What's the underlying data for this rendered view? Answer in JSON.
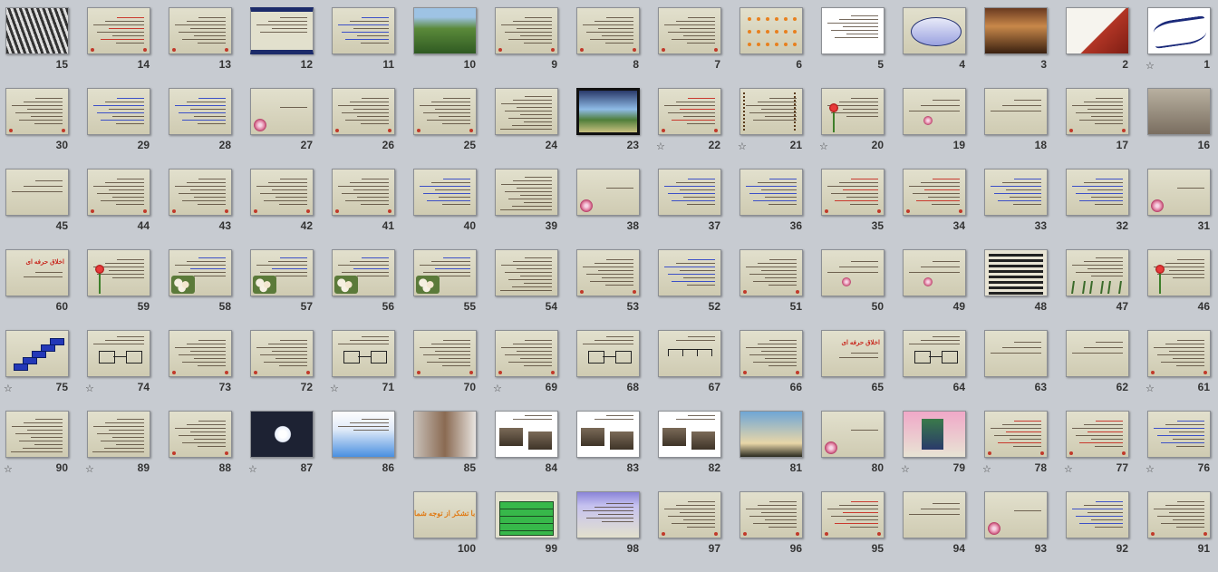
{
  "view": "slide-sorter",
  "slides": [
    {
      "number": "1",
      "text": "",
      "starred": true,
      "kind": "calligraphy"
    },
    {
      "number": "2",
      "text": "",
      "starred": false,
      "kind": "hand-photo"
    },
    {
      "number": "3",
      "text": "",
      "starred": false,
      "kind": "photo-dark"
    },
    {
      "number": "4",
      "text": "",
      "starred": false,
      "kind": "oval"
    },
    {
      "number": "5",
      "text": "",
      "starred": false,
      "kind": "white-list"
    },
    {
      "number": "6",
      "text": "",
      "starred": false,
      "kind": "dots"
    },
    {
      "number": "7",
      "text": "",
      "starred": false,
      "kind": "text"
    },
    {
      "number": "8",
      "text": "",
      "starred": false,
      "kind": "text"
    },
    {
      "number": "9",
      "text": "",
      "starred": false,
      "kind": "text"
    },
    {
      "number": "10",
      "text": "",
      "starred": false,
      "kind": "landscape"
    },
    {
      "number": "11",
      "text": "",
      "starred": false,
      "kind": "text-blue"
    },
    {
      "number": "12",
      "text": "",
      "starred": false,
      "kind": "framed"
    },
    {
      "number": "13",
      "text": "",
      "starred": false,
      "kind": "text"
    },
    {
      "number": "14",
      "text": "",
      "starred": false,
      "kind": "text-red"
    },
    {
      "number": "15",
      "text": "",
      "starred": false,
      "kind": "zebra"
    },
    {
      "number": "16",
      "text": "",
      "starred": false,
      "kind": "rhino"
    },
    {
      "number": "17",
      "text": "",
      "starred": false,
      "kind": "text"
    },
    {
      "number": "18",
      "text": "",
      "starred": false,
      "kind": "sparse"
    },
    {
      "number": "19",
      "text": "",
      "starred": false,
      "kind": "sparse-flower"
    },
    {
      "number": "20",
      "text": "",
      "starred": true,
      "kind": "rose-text"
    },
    {
      "number": "21",
      "text": "",
      "starred": true,
      "kind": "vine"
    },
    {
      "number": "22",
      "text": "",
      "starred": true,
      "kind": "text-red"
    },
    {
      "number": "23",
      "text": "",
      "starred": false,
      "kind": "lake"
    },
    {
      "number": "24",
      "text": "",
      "starred": false,
      "kind": "text-dense"
    },
    {
      "number": "25",
      "text": "",
      "starred": false,
      "kind": "text"
    },
    {
      "number": "26",
      "text": "",
      "starred": false,
      "kind": "text"
    },
    {
      "number": "27",
      "text": "",
      "starred": false,
      "kind": "title-flower"
    },
    {
      "number": "28",
      "text": "",
      "starred": false,
      "kind": "text-blue"
    },
    {
      "number": "29",
      "text": "",
      "starred": false,
      "kind": "text-blue"
    },
    {
      "number": "30",
      "text": "",
      "starred": false,
      "kind": "text"
    },
    {
      "number": "31",
      "text": "",
      "starred": false,
      "kind": "title-flower"
    },
    {
      "number": "32",
      "text": "",
      "starred": false,
      "kind": "text-blue"
    },
    {
      "number": "33",
      "text": "",
      "starred": false,
      "kind": "text-blue"
    },
    {
      "number": "34",
      "text": "",
      "starred": false,
      "kind": "text-red"
    },
    {
      "number": "35",
      "text": "",
      "starred": false,
      "kind": "text-red"
    },
    {
      "number": "36",
      "text": "",
      "starred": false,
      "kind": "text-blue"
    },
    {
      "number": "37",
      "text": "",
      "starred": false,
      "kind": "text-blue"
    },
    {
      "number": "38",
      "text": "",
      "starred": false,
      "kind": "title-flower"
    },
    {
      "number": "39",
      "text": "",
      "starred": false,
      "kind": "text-dense"
    },
    {
      "number": "40",
      "text": "",
      "starred": false,
      "kind": "text-blue"
    },
    {
      "number": "41",
      "text": "",
      "starred": false,
      "kind": "text"
    },
    {
      "number": "42",
      "text": "",
      "starred": false,
      "kind": "text"
    },
    {
      "number": "43",
      "text": "",
      "starred": false,
      "kind": "text"
    },
    {
      "number": "44",
      "text": "",
      "starred": false,
      "kind": "text"
    },
    {
      "number": "45",
      "text": "",
      "starred": false,
      "kind": "sparse"
    },
    {
      "number": "46",
      "text": "",
      "starred": false,
      "kind": "rose-text"
    },
    {
      "number": "47",
      "text": "",
      "starred": false,
      "kind": "grass"
    },
    {
      "number": "48",
      "text": "",
      "starred": false,
      "kind": "table"
    },
    {
      "number": "49",
      "text": "",
      "starred": false,
      "kind": "sparse-flower"
    },
    {
      "number": "50",
      "text": "",
      "starred": false,
      "kind": "sparse-flower"
    },
    {
      "number": "51",
      "text": "",
      "starred": false,
      "kind": "text"
    },
    {
      "number": "52",
      "text": "",
      "starred": false,
      "kind": "text-blue"
    },
    {
      "number": "53",
      "text": "",
      "starred": false,
      "kind": "text"
    },
    {
      "number": "54",
      "text": "",
      "starred": false,
      "kind": "text-dense"
    },
    {
      "number": "55",
      "text": "",
      "starred": false,
      "kind": "bouquet"
    },
    {
      "number": "56",
      "text": "",
      "starred": false,
      "kind": "bouquet"
    },
    {
      "number": "57",
      "text": "",
      "starred": false,
      "kind": "bouquet"
    },
    {
      "number": "58",
      "text": "",
      "starred": false,
      "kind": "bouquet"
    },
    {
      "number": "59",
      "text": "",
      "starred": false,
      "kind": "rose-text"
    },
    {
      "number": "60",
      "text": "اخلاق حرفه ای",
      "starred": false,
      "kind": "title"
    },
    {
      "number": "61",
      "text": "",
      "starred": true,
      "kind": "text"
    },
    {
      "number": "62",
      "text": "",
      "starred": false,
      "kind": "sparse"
    },
    {
      "number": "63",
      "text": "",
      "starred": false,
      "kind": "sparse"
    },
    {
      "number": "64",
      "text": "",
      "starred": false,
      "kind": "diagram"
    },
    {
      "number": "65",
      "text": "اخلاق حرفه ای",
      "starred": false,
      "kind": "title"
    },
    {
      "number": "66",
      "text": "",
      "starred": false,
      "kind": "text"
    },
    {
      "number": "67",
      "text": "",
      "starred": false,
      "kind": "tree"
    },
    {
      "number": "68",
      "text": "",
      "starred": false,
      "kind": "diagram"
    },
    {
      "number": "69",
      "text": "",
      "starred": true,
      "kind": "text"
    },
    {
      "number": "70",
      "text": "",
      "starred": false,
      "kind": "text"
    },
    {
      "number": "71",
      "text": "",
      "starred": true,
      "kind": "diagram"
    },
    {
      "number": "72",
      "text": "",
      "starred": false,
      "kind": "text"
    },
    {
      "number": "73",
      "text": "",
      "starred": false,
      "kind": "text"
    },
    {
      "number": "74",
      "text": "",
      "starred": true,
      "kind": "diagram"
    },
    {
      "number": "75",
      "text": "",
      "starred": true,
      "kind": "stairs"
    },
    {
      "number": "76",
      "text": "",
      "starred": true,
      "kind": "text-blue"
    },
    {
      "number": "77",
      "text": "",
      "starred": true,
      "kind": "text-red"
    },
    {
      "number": "78",
      "text": "",
      "starred": true,
      "kind": "text-red"
    },
    {
      "number": "79",
      "text": "",
      "starred": true,
      "kind": "photo-pink"
    },
    {
      "number": "80",
      "text": "",
      "starred": false,
      "kind": "title-flower"
    },
    {
      "number": "81",
      "text": "",
      "starred": false,
      "kind": "sky"
    },
    {
      "number": "82",
      "text": "",
      "starred": false,
      "kind": "white-photo"
    },
    {
      "number": "83",
      "text": "",
      "starred": false,
      "kind": "white-photo"
    },
    {
      "number": "84",
      "text": "",
      "starred": false,
      "kind": "white-photo"
    },
    {
      "number": "85",
      "text": "",
      "starred": false,
      "kind": "photo-room"
    },
    {
      "number": "86",
      "text": "",
      "starred": false,
      "kind": "blue-gradient"
    },
    {
      "number": "87",
      "text": "",
      "starred": true,
      "kind": "lotus"
    },
    {
      "number": "88",
      "text": "",
      "starred": false,
      "kind": "text"
    },
    {
      "number": "89",
      "text": "",
      "starred": true,
      "kind": "text-dense"
    },
    {
      "number": "90",
      "text": "",
      "starred": true,
      "kind": "text-dense"
    },
    {
      "number": "91",
      "text": "",
      "starred": false,
      "kind": "text"
    },
    {
      "number": "92",
      "text": "",
      "starred": false,
      "kind": "text-blue"
    },
    {
      "number": "93",
      "text": "",
      "starred": false,
      "kind": "title-flower"
    },
    {
      "number": "94",
      "text": "",
      "starred": false,
      "kind": "sparse"
    },
    {
      "number": "95",
      "text": "",
      "starred": false,
      "kind": "text-red"
    },
    {
      "number": "96",
      "text": "",
      "starred": false,
      "kind": "text"
    },
    {
      "number": "97",
      "text": "",
      "starred": false,
      "kind": "text"
    },
    {
      "number": "98",
      "text": "",
      "starred": false,
      "kind": "purple"
    },
    {
      "number": "99",
      "text": "",
      "starred": false,
      "kind": "green-table"
    },
    {
      "number": "100",
      "text": "با تشکر از توجه شما",
      "starred": false,
      "kind": "thanks"
    }
  ],
  "star_glyph": "☆"
}
